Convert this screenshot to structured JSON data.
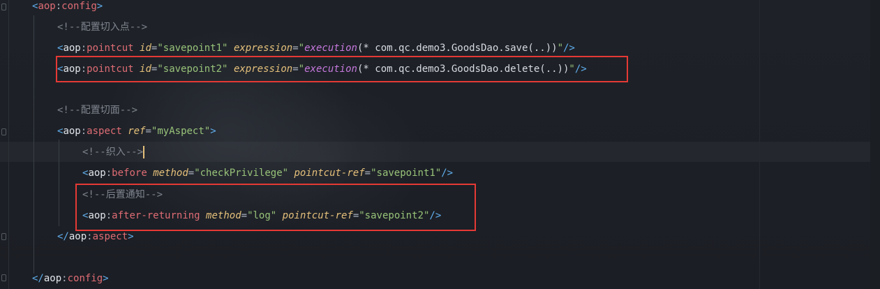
{
  "editor": {
    "lines": {
      "l1": {
        "lt": "<",
        "ns": "aop",
        "colon": ":",
        "name": "config",
        "gt": ">"
      },
      "l2": {
        "text": "<!--配置切入点-->"
      },
      "l3": {
        "lt": "<",
        "ns": "aop",
        "colon": ":",
        "name": "pointcut",
        "a1": "id",
        "eq": "=",
        "v1": "\"savepoint1\"",
        "a2": "expression",
        "q": "\"",
        "fn": "execution",
        "paren": "(",
        "expr": "* com.qc.demo3.GoodsDao.save(..))",
        "qend": "\"",
        "end": "/>"
      },
      "l4": {
        "lt": "<",
        "ns": "aop",
        "colon": ":",
        "name": "pointcut",
        "a1": "id",
        "eq": "=",
        "v1": "\"savepoint2\"",
        "a2": "expression",
        "q": "\"",
        "fn": "execution",
        "paren": "(",
        "expr": "* com.qc.demo3.GoodsDao.delete(..))",
        "qend": "\"",
        "end": "/>"
      },
      "l6": {
        "text": "<!--配置切面-->"
      },
      "l7": {
        "lt": "<",
        "ns": "aop",
        "colon": ":",
        "name": "aspect",
        "a1": "ref",
        "eq": "=",
        "v1": "\"myAspect\"",
        "gt": ">"
      },
      "l8": {
        "text": "<!--织入-->"
      },
      "l9": {
        "lt": "<",
        "ns": "aop",
        "colon": ":",
        "name": "before",
        "a1": "method",
        "eq": "=",
        "v1": "\"checkPrivilege\"",
        "a2": "pointcut-ref",
        "v2": "\"savepoint1\"",
        "end": "/>"
      },
      "l10": {
        "text": "<!--后置通知-->"
      },
      "l11": {
        "lt": "<",
        "ns": "aop",
        "colon": ":",
        "name": "after-returning",
        "a1": "method",
        "eq": "=",
        "v1": "\"log\"",
        "a2": "pointcut-ref",
        "v2": "\"savepoint2\"",
        "end": "/>"
      },
      "l12": {
        "lt": "</",
        "ns": "aop",
        "colon": ":",
        "name": "aspect",
        "gt": ">"
      },
      "l14": {
        "lt": "</",
        "ns": "aop",
        "colon": ":",
        "name": "config",
        "gt": ">"
      }
    }
  },
  "highlight_color": "#e53935"
}
